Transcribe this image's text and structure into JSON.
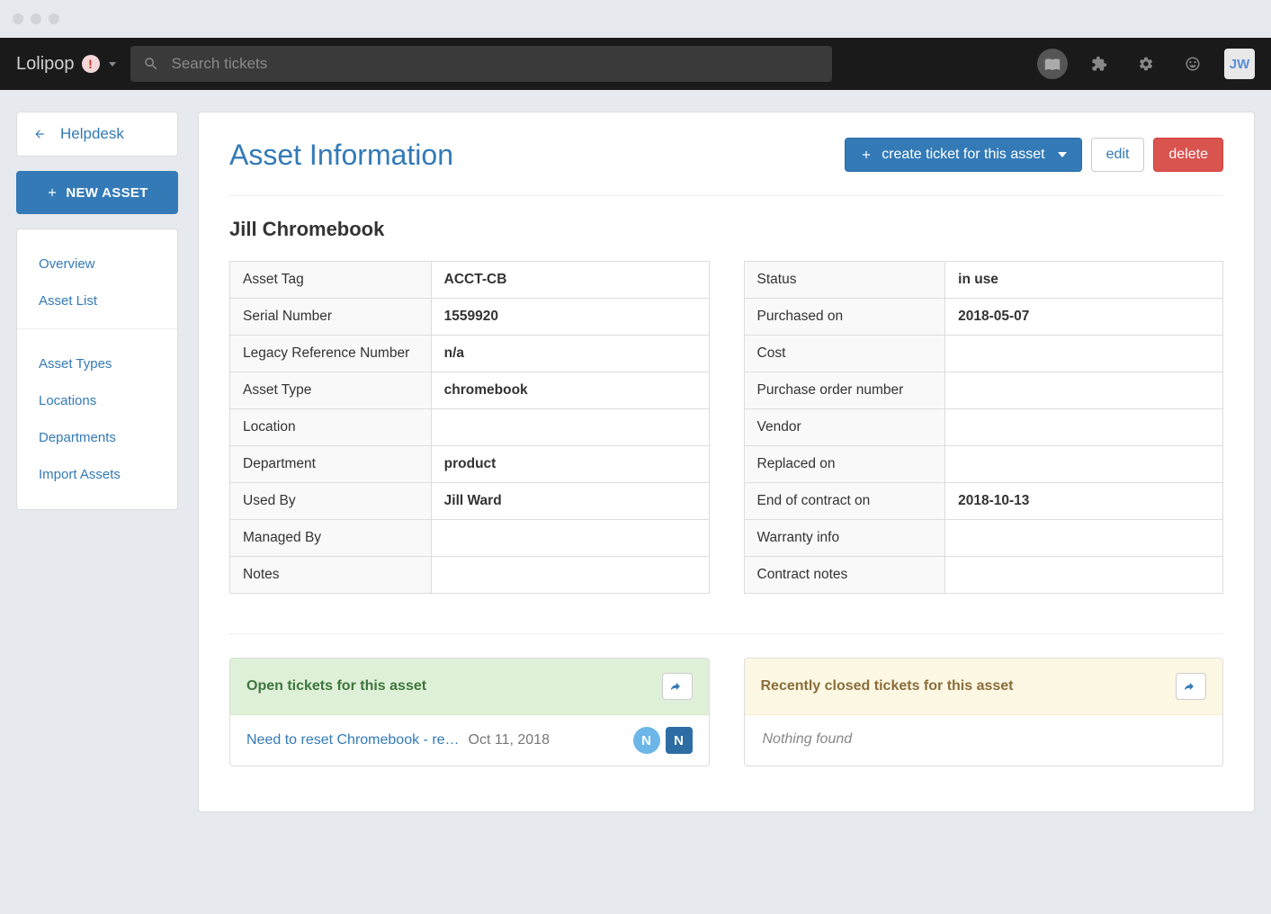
{
  "brand": {
    "name": "Lolipop",
    "badge": "!"
  },
  "search": {
    "placeholder": "Search tickets"
  },
  "avatar": "JW",
  "sidebar": {
    "back_label": "Helpdesk",
    "new_asset_label": "NEW ASSET",
    "group1": [
      "Overview",
      "Asset List"
    ],
    "group2": [
      "Asset Types",
      "Locations",
      "Departments",
      "Import Assets"
    ]
  },
  "header": {
    "title": "Asset Information",
    "create_ticket_label": "create ticket for this asset",
    "edit_label": "edit",
    "delete_label": "delete"
  },
  "asset_name": "Jill Chromebook",
  "left_table": [
    {
      "label": "Asset Tag",
      "value": "ACCT-CB"
    },
    {
      "label": "Serial Number",
      "value": "1559920"
    },
    {
      "label": "Legacy Reference Number",
      "value": "n/a"
    },
    {
      "label": "Asset Type",
      "value": "chromebook"
    },
    {
      "label": "Location",
      "value": ""
    },
    {
      "label": "Department",
      "value": "product"
    },
    {
      "label": "Used By",
      "value": "Jill Ward"
    },
    {
      "label": "Managed By",
      "value": ""
    },
    {
      "label": "Notes",
      "value": ""
    }
  ],
  "right_table": [
    {
      "label": "Status",
      "value": "in use"
    },
    {
      "label": "Purchased on",
      "value": "2018-05-07"
    },
    {
      "label": "Cost",
      "value": ""
    },
    {
      "label": "Purchase order number",
      "value": ""
    },
    {
      "label": "Vendor",
      "value": ""
    },
    {
      "label": "Replaced on",
      "value": ""
    },
    {
      "label": "End of contract on",
      "value": "2018-10-13"
    },
    {
      "label": "Warranty info",
      "value": ""
    },
    {
      "label": "Contract notes",
      "value": ""
    }
  ],
  "open_panel": {
    "title": "Open tickets for this asset",
    "tickets": [
      {
        "title": "Need to reset Chromebook - re…",
        "date": "Oct 11, 2018",
        "badge1": "N",
        "badge1_color": "#6cb7e8",
        "badge2": "N",
        "badge2_color": "#2e6da4"
      }
    ]
  },
  "closed_panel": {
    "title": "Recently closed tickets for this asset",
    "empty_text": "Nothing found"
  }
}
